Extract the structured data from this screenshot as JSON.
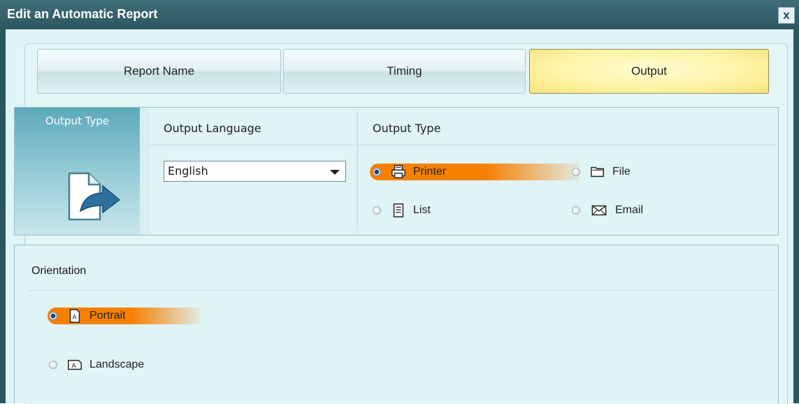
{
  "window": {
    "title": "Edit an Automatic Report",
    "close_label": "x"
  },
  "tabs": [
    {
      "label": "Report Name",
      "active": false
    },
    {
      "label": "Timing",
      "active": false
    },
    {
      "label": "Output",
      "active": true
    }
  ],
  "section_output": {
    "tile_label": "Output Type",
    "language": {
      "heading": "Output Language",
      "selected": "English"
    },
    "type": {
      "heading": "Output Type",
      "options": [
        {
          "label": "Printer",
          "icon": "printer-icon",
          "selected": true
        },
        {
          "label": "File",
          "icon": "folder-icon",
          "selected": false
        },
        {
          "label": "List",
          "icon": "list-icon",
          "selected": false
        },
        {
          "label": "Email",
          "icon": "envelope-icon",
          "selected": false
        }
      ]
    }
  },
  "section_orientation": {
    "heading": "Orientation",
    "options": [
      {
        "label": "Portrait",
        "icon": "portrait-page-icon",
        "selected": true
      },
      {
        "label": "Landscape",
        "icon": "landscape-page-icon",
        "selected": false
      }
    ]
  },
  "colors": {
    "title_bar": "#2c5761",
    "selection_highlight": "#f68000",
    "active_tab": "#fff4a8",
    "panel_bg": "#e0f3f5"
  }
}
